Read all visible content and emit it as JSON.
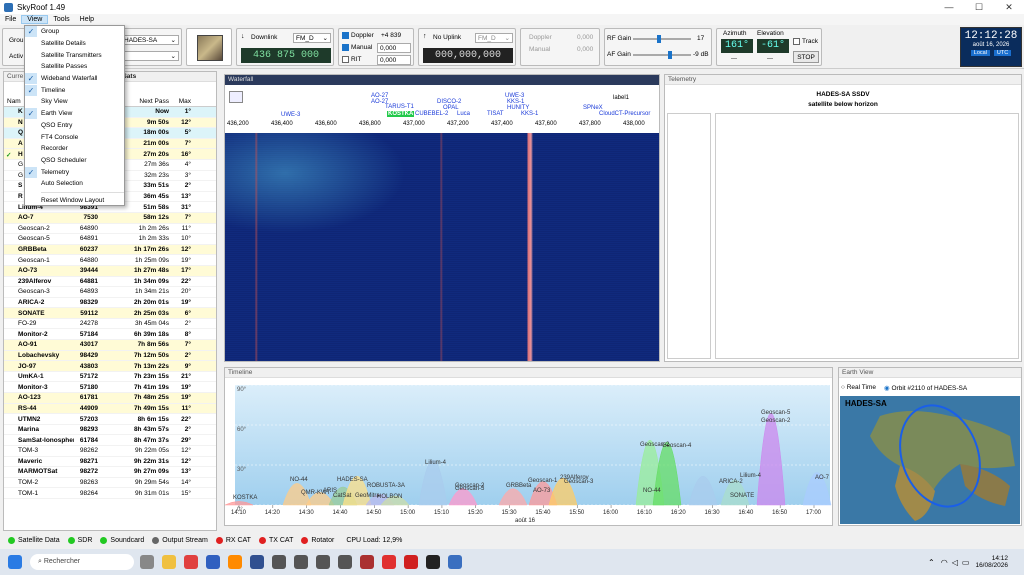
{
  "app": {
    "title": "SkyRoof 1.49"
  },
  "menu": {
    "file": "File",
    "view": "View",
    "tools": "Tools",
    "help": "Help"
  },
  "view_menu": {
    "items": [
      {
        "label": "Group",
        "checked": true
      },
      {
        "label": "Satellite Details",
        "checked": false
      },
      {
        "label": "Satellite Transmitters",
        "checked": false
      },
      {
        "label": "Satellite Passes",
        "checked": false
      },
      {
        "label": "Wideband Waterfall",
        "checked": true
      },
      {
        "label": "Timeline",
        "checked": true
      },
      {
        "label": "Sky View",
        "checked": false
      },
      {
        "label": "Earth View",
        "checked": true
      },
      {
        "label": "QSO Entry",
        "checked": false
      },
      {
        "label": "FT4 Console",
        "checked": false
      },
      {
        "label": "Recorder",
        "checked": false
      },
      {
        "label": "QSO Scheduler",
        "checked": false
      },
      {
        "label": "Telemetry",
        "checked": true
      },
      {
        "label": "Auto Selection",
        "checked": false
      }
    ],
    "reset": "Reset Window Layout"
  },
  "toolbar": {
    "group_label": "Grou",
    "active_label": "Activ",
    "sat_select": "HADES-SA",
    "downlink_label": "Downlink",
    "downlink_mode": "FM_D",
    "downlink_freq": "436 875 000",
    "doppler_label": "Doppler",
    "doppler_value": "+4 839",
    "manual_label": "Manual",
    "manual_value": "0,000",
    "rit_label": "RIT",
    "rit_value": "0,000",
    "uplink_label": "No Uplink",
    "uplink_mode": "FM_D",
    "uplink_freq": "000,000,000",
    "up_doppler_label": "Doppler",
    "up_doppler_value": "0,000",
    "up_manual_label": "Manual",
    "up_manual_value": "0,000",
    "rf_gain_label": "RF Gain",
    "rf_gain_value": "17",
    "af_gain_label": "AF Gain",
    "af_gain_value": "-9 dB",
    "rf_gain_level": 0.45,
    "af_gain_level": 0.65,
    "azimuth_label": "Azimuth",
    "azimuth_value": "161°",
    "elevation_label": "Elevation",
    "elevation_value": "-61°",
    "track_label": "Track",
    "stop_label": "STOP",
    "az_sub": "---",
    "el_sub": "---",
    "clock_time": "12:12:28",
    "clock_date": "août 16, 2026",
    "clock_local": "Local",
    "clock_utc": "UTC"
  },
  "sat_panel": {
    "title": "Curre",
    "group_suffix": "am Sats",
    "headers": {
      "name": "Nam",
      "id": "D ID",
      "next": "Next Pass",
      "max": "Max"
    },
    "rows": [
      {
        "name": "K",
        "id": "",
        "next": "Now",
        "max": "1°",
        "bold": true,
        "bg": "cyan"
      },
      {
        "name": "N",
        "id": "",
        "next": "9m 50s",
        "max": "12°",
        "bold": true,
        "bg": "yel"
      },
      {
        "name": "Q",
        "id": "",
        "next": "18m 00s",
        "max": "5°",
        "bold": true,
        "bg": "cyan"
      },
      {
        "name": "A",
        "id": "",
        "next": "21m 00s",
        "max": "7°",
        "bold": true,
        "bg": "yel"
      },
      {
        "name": "H",
        "id": "",
        "next": "27m 20s",
        "max": "16°",
        "bold": true,
        "bg": "yel",
        "check": true
      },
      {
        "name": "G",
        "id": "",
        "next": "27m 36s",
        "max": "4°",
        "bold": false,
        "bg": ""
      },
      {
        "name": "G",
        "id": "",
        "next": "32m 23s",
        "max": "3°",
        "bold": false,
        "bg": ""
      },
      {
        "name": "S",
        "id": "",
        "next": "33m 51s",
        "max": "2°",
        "bold": true,
        "bg": ""
      },
      {
        "name": "R",
        "id": "",
        "next": "36m 45s",
        "max": "13°",
        "bold": true,
        "bg": ""
      },
      {
        "name": "Lilium-4",
        "id": "98391",
        "next": "51m 58s",
        "max": "31°",
        "bold": true,
        "bg": ""
      },
      {
        "name": "AO-7",
        "id": "7530",
        "next": "58m 12s",
        "max": "7°",
        "bold": true,
        "bg": "yel"
      },
      {
        "name": "Geoscan-2",
        "id": "64890",
        "next": "1h 2m 26s",
        "max": "11°",
        "bold": false,
        "bg": ""
      },
      {
        "name": "Geoscan-5",
        "id": "64891",
        "next": "1h 2m 33s",
        "max": "10°",
        "bold": false,
        "bg": ""
      },
      {
        "name": "GRBBeta",
        "id": "60237",
        "next": "1h 17m 26s",
        "max": "12°",
        "bold": true,
        "bg": "yel"
      },
      {
        "name": "Geoscan-1",
        "id": "64880",
        "next": "1h 25m 09s",
        "max": "19°",
        "bold": false,
        "bg": ""
      },
      {
        "name": "AO-73",
        "id": "39444",
        "next": "1h 27m 48s",
        "max": "17°",
        "bold": true,
        "bg": "yel"
      },
      {
        "name": "239Alferov",
        "id": "64881",
        "next": "1h 34m 09s",
        "max": "22°",
        "bold": true,
        "bg": ""
      },
      {
        "name": "Geoscan-3",
        "id": "64893",
        "next": "1h 34m 21s",
        "max": "20°",
        "bold": false,
        "bg": ""
      },
      {
        "name": "ARICA-2",
        "id": "98329",
        "next": "2h 20m 01s",
        "max": "19°",
        "bold": true,
        "bg": ""
      },
      {
        "name": "SONATE",
        "id": "59112",
        "next": "2h 25m 03s",
        "max": "6°",
        "bold": true,
        "bg": "yel"
      },
      {
        "name": "FO-29",
        "id": "24278",
        "next": "3h 45m 04s",
        "max": "2°",
        "bold": false,
        "bg": ""
      },
      {
        "name": "Monitor-2",
        "id": "57184",
        "next": "6h 39m 18s",
        "max": "8°",
        "bold": true,
        "bg": ""
      },
      {
        "name": "AO-91",
        "id": "43017",
        "next": "7h 8m 56s",
        "max": "7°",
        "bold": true,
        "bg": "yel"
      },
      {
        "name": "Lobachevsky",
        "id": "98429",
        "next": "7h 12m 50s",
        "max": "2°",
        "bold": true,
        "bg": "yel"
      },
      {
        "name": "JO-97",
        "id": "43803",
        "next": "7h 13m 22s",
        "max": "9°",
        "bold": true,
        "bg": "yel"
      },
      {
        "name": "UmKA-1",
        "id": "57172",
        "next": "7h 23m 15s",
        "max": "21°",
        "bold": true,
        "bg": ""
      },
      {
        "name": "Monitor-3",
        "id": "57180",
        "next": "7h 41m 19s",
        "max": "19°",
        "bold": true,
        "bg": ""
      },
      {
        "name": "AO-123",
        "id": "61781",
        "next": "7h 48m 25s",
        "max": "19°",
        "bold": true,
        "bg": "yel"
      },
      {
        "name": "RS-44",
        "id": "44909",
        "next": "7h 49m 15s",
        "max": "11°",
        "bold": true,
        "bg": "yel"
      },
      {
        "name": "UTMN2",
        "id": "57203",
        "next": "8h 6m 15s",
        "max": "22°",
        "bold": true,
        "bg": ""
      },
      {
        "name": "Marina",
        "id": "98293",
        "next": "8h 43m 57s",
        "max": "2°",
        "bold": true,
        "bg": ""
      },
      {
        "name": "SamSat-Ionosphere",
        "id": "61784",
        "next": "8h 47m 37s",
        "max": "29°",
        "bold": true,
        "bg": ""
      },
      {
        "name": "TOM-3",
        "id": "98262",
        "next": "9h 22m 05s",
        "max": "12°",
        "bold": false,
        "bg": ""
      },
      {
        "name": "Maveric",
        "id": "98271",
        "next": "9h 22m 31s",
        "max": "12°",
        "bold": true,
        "bg": ""
      },
      {
        "name": "MARMOTSat",
        "id": "98272",
        "next": "9h 27m 09s",
        "max": "13°",
        "bold": true,
        "bg": ""
      },
      {
        "name": "TOM-2",
        "id": "98263",
        "next": "9h 29m 54s",
        "max": "14°",
        "bold": false,
        "bg": ""
      },
      {
        "name": "TOM-1",
        "id": "98264",
        "next": "9h 31m 01s",
        "max": "15°",
        "bold": false,
        "bg": ""
      }
    ]
  },
  "waterfall": {
    "title": "Waterfall",
    "label1": "label1",
    "ticks": [
      "436,200",
      "436,400",
      "436,600",
      "436,800",
      "437,000",
      "437,200",
      "437,400",
      "437,600",
      "437,800",
      "438,000"
    ],
    "sat_labels": [
      "UWE-3",
      "AO-27",
      "AO-27",
      "TARUS-T1",
      "KOSTKA",
      "CUBEBEL-2",
      "DISCO-2",
      "OPAL",
      "Luca",
      "TISAT",
      "UWE-3",
      "KKS-1",
      "HUNITY",
      "KKS-1",
      "SPNeX",
      "CloudCT-Precursor"
    ]
  },
  "telemetry": {
    "title": "Telemetry",
    "sat": "HADES-SA  SSDV",
    "status": "satellite below horizon"
  },
  "timeline": {
    "title": "Timeline",
    "yticks": [
      "90°",
      "60°",
      "30°",
      "0°"
    ],
    "xticks": [
      "14:10",
      "14:20",
      "14:30",
      "14:40",
      "14:50",
      "15:00",
      "15:10",
      "15:20",
      "15:30",
      "15:40",
      "15:50",
      "16:00",
      "16:10",
      "16:20",
      "16:30",
      "16:40",
      "16:50",
      "17:00"
    ],
    "date_label": "août 16",
    "pass_labels": [
      "KOSTKA",
      "NO-44",
      "QMR-KWT",
      "HADES-SA",
      "ARIS",
      "CatSat",
      "GeoMitra",
      "ROBUSTA-3A",
      "HOLBON",
      "Lilium-4",
      "Geoscan-5",
      "Geoscan-2",
      "GRBBeta",
      "Geoscan-1",
      "AO-73",
      "239Alferov",
      "Geoscan-3",
      "Geoscan-2",
      "Geoscan-4",
      "NO-44",
      "ARICA-2",
      "SONATE",
      "Lilium-4",
      "Geoscan-5",
      "Geoscan-2",
      "AO-7"
    ]
  },
  "earth": {
    "title": "Earth View",
    "realtime": "Real Time",
    "orbit": "Orbit #2110 of HADES-SA",
    "sat": "HADES-SA"
  },
  "status": {
    "sat_data": "Satellite Data",
    "sdr": "SDR",
    "soundcard": "Soundcard",
    "output": "Output Stream",
    "rxcat": "RX CAT",
    "txcat": "TX CAT",
    "rotator": "Rotator",
    "cpu": "CPU Load: 12,9%"
  },
  "taskbar": {
    "search": "Rechercher",
    "time": "14:12",
    "date": "16/08/2026"
  }
}
